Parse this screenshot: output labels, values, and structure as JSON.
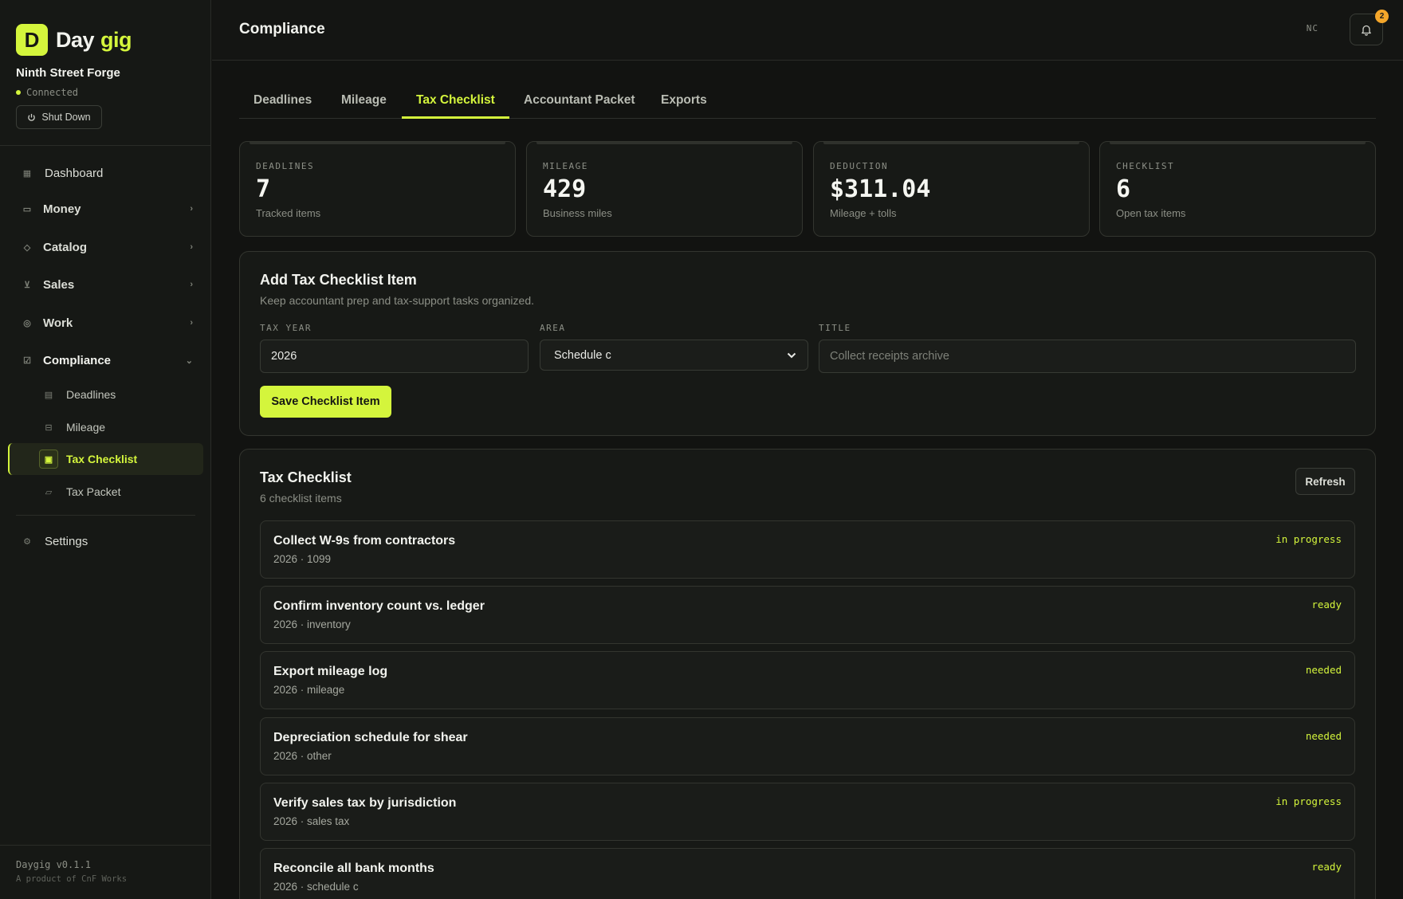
{
  "brand": {
    "logo_letter": "D",
    "name_a": "Day",
    "name_b": "gig"
  },
  "org": {
    "name": "Ninth Street Forge",
    "status": "Connected",
    "shutdown_label": "Shut Down"
  },
  "nav": {
    "dashboard": "Dashboard",
    "money": "Money",
    "catalog": "Catalog",
    "sales": "Sales",
    "work": "Work",
    "compliance": "Compliance",
    "sub": {
      "deadlines": "Deadlines",
      "mileage": "Mileage",
      "tax_checklist": "Tax Checklist",
      "tax_packet": "Tax Packet"
    },
    "settings": "Settings"
  },
  "footer": {
    "version": "Daygig v0.1.1",
    "tagline": "A product of CnF Works"
  },
  "header": {
    "title": "Compliance",
    "initials": "NC",
    "notifications": "2"
  },
  "tabs": [
    "Deadlines",
    "Mileage",
    "Tax Checklist",
    "Accountant Packet",
    "Exports"
  ],
  "stats": [
    {
      "label": "DEADLINES",
      "value": "7",
      "sub": "Tracked items"
    },
    {
      "label": "MILEAGE",
      "value": "429",
      "sub": "Business miles"
    },
    {
      "label": "DEDUCTION",
      "value": "$311.04",
      "sub": "Mileage + tolls"
    },
    {
      "label": "CHECKLIST",
      "value": "6",
      "sub": "Open tax items"
    }
  ],
  "form": {
    "title": "Add Tax Checklist Item",
    "subtitle": "Keep accountant prep and tax-support tasks organized.",
    "tax_year_label": "TAX YEAR",
    "tax_year_value": "2026",
    "area_label": "AREA",
    "area_value": "Schedule c",
    "title_label": "TITLE",
    "title_placeholder": "Collect receipts archive",
    "save_label": "Save Checklist Item"
  },
  "checklist": {
    "title": "Tax Checklist",
    "count": "6 checklist items",
    "refresh_label": "Refresh",
    "items": [
      {
        "title": "Collect W-9s from contractors",
        "meta": "2026 · 1099",
        "status": "in progress"
      },
      {
        "title": "Confirm inventory count vs. ledger",
        "meta": "2026 · inventory",
        "status": "ready"
      },
      {
        "title": "Export mileage log",
        "meta": "2026 · mileage",
        "status": "needed"
      },
      {
        "title": "Depreciation schedule for shear",
        "meta": "2026 · other",
        "status": "needed"
      },
      {
        "title": "Verify sales tax by jurisdiction",
        "meta": "2026 · sales tax",
        "status": "in progress"
      },
      {
        "title": "Reconcile all bank months",
        "meta": "2026 · schedule c",
        "status": "ready"
      }
    ]
  },
  "colors": {
    "accent": "#d4f53c",
    "badge": "#f4a62a",
    "background": "#121311"
  }
}
